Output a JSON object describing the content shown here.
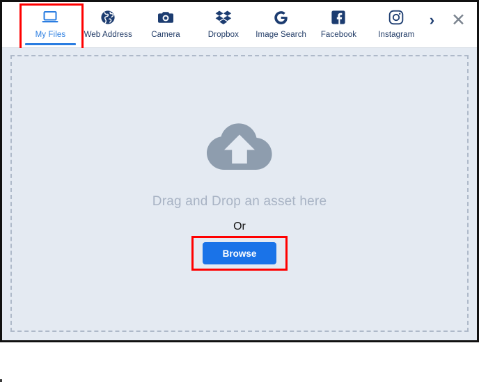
{
  "modal": {
    "tabs": [
      {
        "label": "My Files",
        "icon": "laptop-icon",
        "active": true
      },
      {
        "label": "Web Address",
        "icon": "globe-icon",
        "active": false
      },
      {
        "label": "Camera",
        "icon": "camera-icon",
        "active": false
      },
      {
        "label": "Dropbox",
        "icon": "dropbox-icon",
        "active": false
      },
      {
        "label": "Image Search",
        "icon": "google-g-icon",
        "active": false
      },
      {
        "label": "Facebook",
        "icon": "facebook-icon",
        "active": false
      },
      {
        "label": "Instagram",
        "icon": "instagram-icon",
        "active": false
      }
    ],
    "next_arrow": "›",
    "close": "✕",
    "drop_zone": {
      "icon": "cloud-upload-icon",
      "hint": "Drag and Drop an asset here",
      "or": "Or",
      "browse_label": "Browse"
    },
    "colors": {
      "accent_blue": "#1a73e8",
      "tab_navy": "#213b66",
      "active_tab_blue": "#2a7de1",
      "panel_bg": "#e4eaf2",
      "dashed_border": "#aeb9c9",
      "hint_text": "#a8b3c4",
      "highlight_red": "#ff0000",
      "cloud_gray": "#8e9dae"
    }
  }
}
